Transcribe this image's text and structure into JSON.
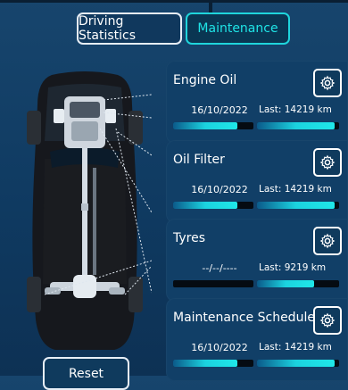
{
  "tabs": {
    "driving_statistics": "Driving Statistics",
    "maintenance": "Maintenance"
  },
  "cards": [
    {
      "title": "Engine Oil",
      "date": "16/10/2022",
      "last": "Last: 14219  km",
      "progress_left": 0.8,
      "progress_right": 0.95
    },
    {
      "title": "Oil Filter",
      "date": "16/10/2022",
      "last": "Last: 14219  km",
      "progress_left": 0.8,
      "progress_right": 0.95
    },
    {
      "title": "Tyres",
      "date": "--/--/----",
      "last": "Last: 9219  km",
      "progress_left": 0.0,
      "progress_right": 0.7
    },
    {
      "title": "Maintenance Schedule",
      "date": "16/10/2022",
      "last": "Last: 14219  km",
      "progress_left": 0.8,
      "progress_right": 0.95
    }
  ],
  "reset_label": "Reset",
  "colors": {
    "accent": "#1fe4e6",
    "panel": "#113f67",
    "bg": "#0f3a61"
  }
}
